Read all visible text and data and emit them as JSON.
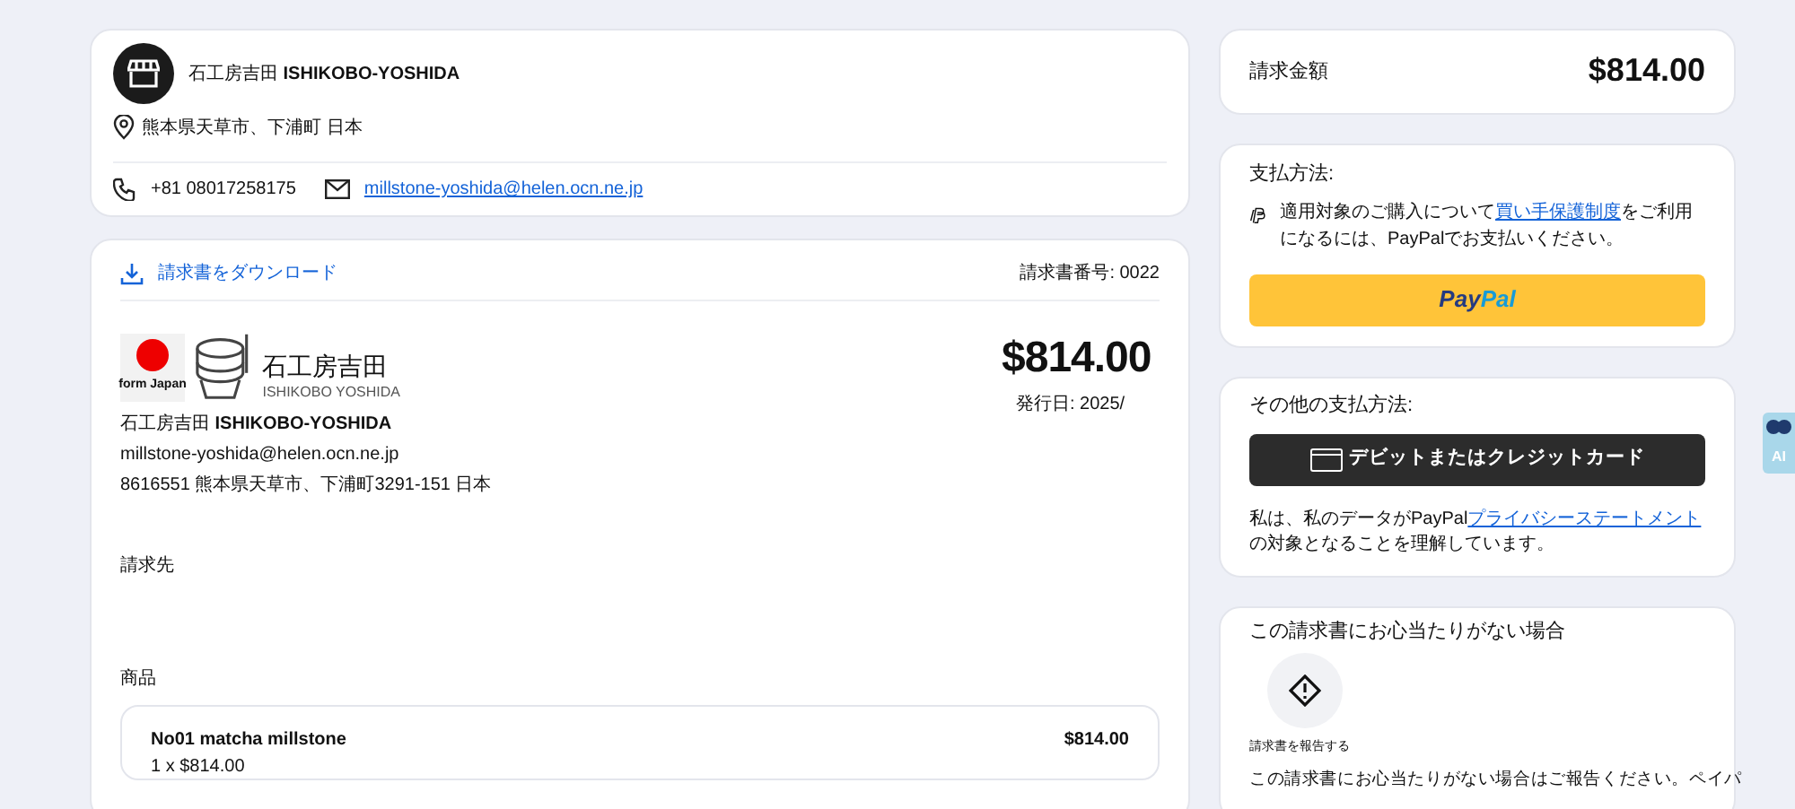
{
  "merchant": {
    "name_jp": "石工房吉田",
    "name_en": "ISHIKOBO-YOSHIDA",
    "location": "熊本県天草市、下浦町 日本",
    "phone": "+81 08017258175",
    "email": "millstone-yoshida@helen.ocn.ne.jp"
  },
  "invoice": {
    "download": "請求書をダウンロード",
    "number": "請求書番号: 0022",
    "logo": {
      "flag_caption": "form Japan",
      "name_jp": "石工房吉田",
      "name_en": "ISHIKOBO YOSHIDA"
    },
    "seller_name_jp": "石工房吉田",
    "seller_name_en": "ISHIKOBO-YOSHIDA",
    "seller_email": "millstone-yoshida@helen.ocn.ne.jp",
    "seller_address": "8616551 熊本県天草市、下浦町3291-151 日本",
    "amount": "$814.00",
    "issue_date": "発行日: 2025/",
    "bill_to_label": "請求先",
    "items_label": "商品",
    "items": [
      {
        "name": "No01 matcha millstone",
        "price": "$814.00",
        "qty": "1 x $814.00"
      }
    ]
  },
  "summary": {
    "label": "請求金額",
    "amount": "$814.00"
  },
  "payment": {
    "title": "支払方法:",
    "notice_before": "適用対象のご購入について",
    "notice_link": "買い手保護制度",
    "notice_after": "をご利用になるには、PayPalでお支払いください。",
    "button_pay": "Pay",
    "button_pal": "Pal"
  },
  "other_payment": {
    "title": "その他の支払方法:",
    "card_button": "デビットまたはクレジットカード",
    "privacy_before": "私は、私のデータがPayPal",
    "privacy_link": "プライバシーステートメント",
    "privacy_after": "の対象となることを理解しています。"
  },
  "report": {
    "title": "この請求書にお心当たりがない場合",
    "button": "請求書を報告する",
    "text": "この請求書にお心当たりがない場合はご報告ください。ペイパ"
  },
  "translate_widget": {
    "label": "AI"
  }
}
